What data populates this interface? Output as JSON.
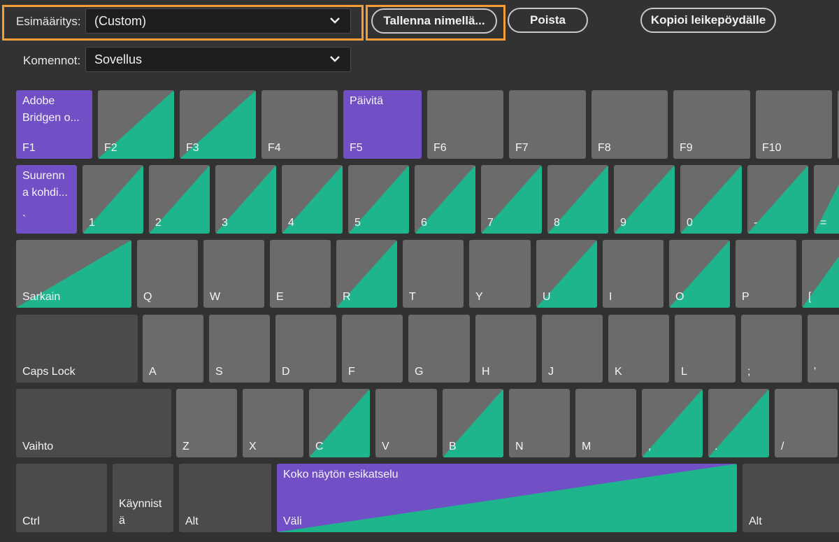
{
  "toolbar": {
    "preset_label": "Esimääritys:",
    "preset_value": "(Custom)",
    "save_as_label": "Tallenna nimellä...",
    "delete_label": "Poista",
    "copy_label": "Kopioi leikepöydälle",
    "commands_label": "Komennot:",
    "commands_value": "Sovellus",
    "highlight_color": "#f29d38"
  },
  "colors": {
    "key_default": "#6b6b6b",
    "key_modifier": "#4b4b4b",
    "assigned_command": "#7150c6",
    "modifier_shortcut": "#1eb48c",
    "background": "#323232"
  },
  "keys": {
    "f1": {
      "label": "F1",
      "command": "Adobe Bridgen o..."
    },
    "f2": {
      "label": "F2"
    },
    "f3": {
      "label": "F3"
    },
    "f4": {
      "label": "F4"
    },
    "f5": {
      "label": "F5",
      "command": "Päivitä"
    },
    "f6": {
      "label": "F6"
    },
    "f7": {
      "label": "F7"
    },
    "f8": {
      "label": "F8"
    },
    "f9": {
      "label": "F9"
    },
    "f10": {
      "label": "F10"
    },
    "backtick": {
      "label": "`",
      "command": "Suurenn a kohdi..."
    },
    "d1": {
      "label": "1"
    },
    "d2": {
      "label": "2"
    },
    "d3": {
      "label": "3"
    },
    "d4": {
      "label": "4"
    },
    "d5": {
      "label": "5"
    },
    "d6": {
      "label": "6"
    },
    "d7": {
      "label": "7"
    },
    "d8": {
      "label": "8"
    },
    "d9": {
      "label": "9"
    },
    "d0": {
      "label": "0"
    },
    "minus": {
      "label": "-"
    },
    "equals": {
      "label": "="
    },
    "tab": {
      "label": "Sarkain"
    },
    "q": {
      "label": "Q"
    },
    "w": {
      "label": "W"
    },
    "e": {
      "label": "E"
    },
    "r": {
      "label": "R"
    },
    "t": {
      "label": "T"
    },
    "y": {
      "label": "Y"
    },
    "u": {
      "label": "U"
    },
    "i": {
      "label": "I"
    },
    "o": {
      "label": "O"
    },
    "p": {
      "label": "P"
    },
    "lbracket": {
      "label": "["
    },
    "capslock": {
      "label": "Caps Lock"
    },
    "a": {
      "label": "A"
    },
    "s": {
      "label": "S"
    },
    "d": {
      "label": "D"
    },
    "f": {
      "label": "F"
    },
    "g": {
      "label": "G"
    },
    "h": {
      "label": "H"
    },
    "j": {
      "label": "J"
    },
    "k": {
      "label": "K"
    },
    "l": {
      "label": "L"
    },
    "semicolon": {
      "label": ";"
    },
    "quote": {
      "label": "'"
    },
    "shift": {
      "label": "Vaihto"
    },
    "z": {
      "label": "Z"
    },
    "x": {
      "label": "X"
    },
    "c": {
      "label": "C"
    },
    "v": {
      "label": "V"
    },
    "b": {
      "label": "B"
    },
    "n": {
      "label": "N"
    },
    "m": {
      "label": "M"
    },
    "comma": {
      "label": ","
    },
    "period": {
      "label": "."
    },
    "slash": {
      "label": "/"
    },
    "ctrl": {
      "label": "Ctrl"
    },
    "start": {
      "label": "Käynnist ä"
    },
    "alt_left": {
      "label": "Alt"
    },
    "space": {
      "label": "Väli",
      "command": "Koko näytön esikatselu"
    },
    "alt_right": {
      "label": "Alt"
    }
  }
}
